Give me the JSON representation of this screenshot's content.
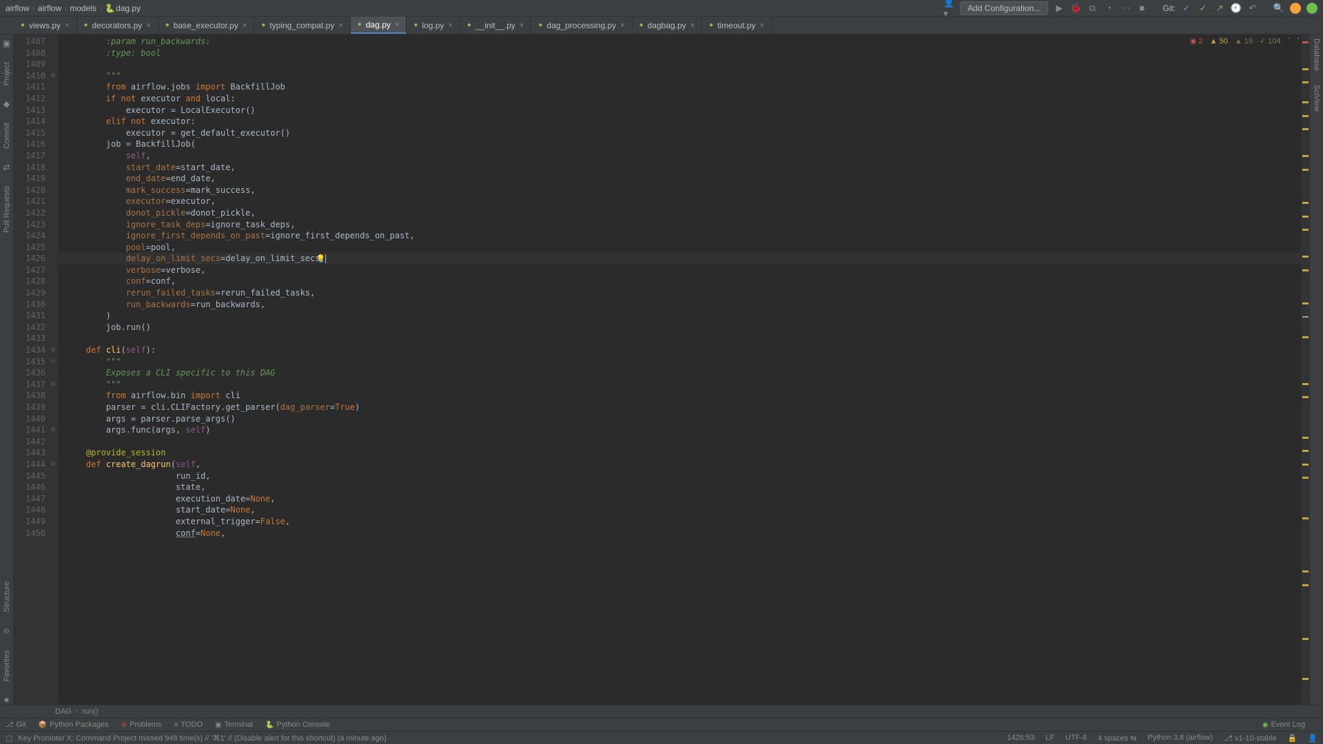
{
  "breadcrumb": [
    "airflow",
    "airflow",
    "models",
    "dag.py"
  ],
  "config_button": "Add Configuration...",
  "git_label": "Git:",
  "tabs": [
    {
      "label": "views.py",
      "active": false
    },
    {
      "label": "decorators.py",
      "active": false
    },
    {
      "label": "base_executor.py",
      "active": false
    },
    {
      "label": "typing_compat.py",
      "active": false
    },
    {
      "label": "dag.py",
      "active": true
    },
    {
      "label": "log.py",
      "active": false
    },
    {
      "label": "__init__.py",
      "active": false
    },
    {
      "label": "dag_processing.py",
      "active": false
    },
    {
      "label": "dagbag.py",
      "active": false
    },
    {
      "label": "timeout.py",
      "active": false
    }
  ],
  "left_tools": [
    "Project",
    "Commit",
    "Pull Requests",
    "Structure",
    "Favorites"
  ],
  "right_tools": [
    "Database",
    "SciView"
  ],
  "inspections": {
    "errors": "2",
    "warnings": "50",
    "weak": "19",
    "typos": "104"
  },
  "line_start": 1407,
  "line_end": 1450,
  "current_line": 1426,
  "bulb_line": 1426,
  "code_lines": [
    "        <span class='doc'>:param run_backwards:</span>",
    "        <span class='doc'>:type: bool</span>",
    "",
    "        <span class='doc'>\"\"\"</span>",
    "        <span class='kw'>from </span>airflow.jobs <span class='kw'>import </span>BackfillJob",
    "        <span class='kw'>if not </span>executor <span class='kw'>and </span>local:",
    "            executor = LocalExecutor()",
    "        <span class='kw'>elif not </span>executor:",
    "            executor = get_default_executor()",
    "        job = BackfillJob(",
    "            <span class='self'>self</span>,",
    "            <span class='param'>start_date</span>=start_date,",
    "            <span class='param'>end_date</span>=end_date,",
    "            <span class='param'>mark_success</span>=mark_success,",
    "            <span class='param'>executor</span>=executor,",
    "            <span class='param'>donot_pickle</span>=donot_pickle,",
    "            <span class='param'>ignore_task_deps</span>=ignore_task_deps,",
    "            <span class='param'>ignore_first_depends_on_past</span>=ignore_first_depends_on_past,",
    "            <span class='param'>pool</span>=pool,",
    "            <span class='param'>delay_on_limit_secs</span>=delay_on_limit_secs,<span class='caret'></span>",
    "            <span class='param'>verbose</span>=verbose,",
    "            <span class='param'>conf</span>=conf,",
    "            <span class='param'>rerun_failed_tasks</span>=rerun_failed_tasks,",
    "            <span class='param'>run_backwards</span>=run_backwards,",
    "        )",
    "        job.run()",
    "",
    "    <span class='kw'>def </span><span class='fn'>cli</span>(<span class='self'>self</span>):",
    "        <span class='doc'>\"\"\"</span>",
    "        <span class='doc'>Exposes a CLI specific to this DAG</span>",
    "        <span class='doc'>\"\"\"</span>",
    "        <span class='kw'>from </span>airflow.bin <span class='kw'>import </span>cli",
    "        parser = cli.CLIFactory.get_parser(<span class='param'>dag_parser</span>=<span class='kw'>True</span>)",
    "        args = parser.parse_args()",
    "        args.func(args, <span class='self'>self</span>)",
    "",
    "    <span class='deco'>@provide_session</span>",
    "    <span class='kw'>def </span><span class='fn'>create_dagrun</span>(<span class='self'>self</span>,",
    "                      run_id,",
    "                      state,",
    "                      execution_date=<span class='kw'>None</span>,",
    "                      start_date=<span class='kw'>None</span>,",
    "                      external_trigger=<span class='kw'>False</span>,",
    "                      <span class='under'>conf</span>=<span class='kw'>None</span>,"
  ],
  "fold_marks": {
    "1410": "⊟",
    "1434": "⊟",
    "1435": "⊟",
    "1437": "⊟",
    "1441": "⊟",
    "1444": "⊟"
  },
  "stripe_marks": [
    {
      "pct": 1,
      "cls": "m-e"
    },
    {
      "pct": 5,
      "cls": "m-w"
    },
    {
      "pct": 7,
      "cls": "m-w"
    },
    {
      "pct": 10,
      "cls": "m-w"
    },
    {
      "pct": 12,
      "cls": "m-w"
    },
    {
      "pct": 14,
      "cls": "m-w"
    },
    {
      "pct": 18,
      "cls": "m-w"
    },
    {
      "pct": 20,
      "cls": "m-w"
    },
    {
      "pct": 25,
      "cls": "m-w"
    },
    {
      "pct": 27,
      "cls": "m-w"
    },
    {
      "pct": 29,
      "cls": "m-w"
    },
    {
      "pct": 33,
      "cls": "m-w"
    },
    {
      "pct": 35,
      "cls": "m-w"
    },
    {
      "pct": 40,
      "cls": "m-w"
    },
    {
      "pct": 42,
      "cls": "m-cur"
    },
    {
      "pct": 45,
      "cls": "m-w"
    },
    {
      "pct": 52,
      "cls": "m-w"
    },
    {
      "pct": 54,
      "cls": "m-w"
    },
    {
      "pct": 60,
      "cls": "m-w"
    },
    {
      "pct": 62,
      "cls": "m-w"
    },
    {
      "pct": 64,
      "cls": "m-w"
    },
    {
      "pct": 66,
      "cls": "m-w"
    },
    {
      "pct": 72,
      "cls": "m-w"
    },
    {
      "pct": 80,
      "cls": "m-w"
    },
    {
      "pct": 82,
      "cls": "m-w"
    },
    {
      "pct": 90,
      "cls": "m-w"
    },
    {
      "pct": 96,
      "cls": "m-w"
    }
  ],
  "context": [
    "DAG",
    "run()"
  ],
  "bottom_tools": [
    {
      "icon": "⎇",
      "label": "Git"
    },
    {
      "icon": "📦",
      "label": "Python Packages"
    },
    {
      "icon": "⊘",
      "label": "Problems",
      "color": "#c75450"
    },
    {
      "icon": "≡",
      "label": "TODO"
    },
    {
      "icon": "▣",
      "label": "Terminal"
    },
    {
      "icon": "🐍",
      "label": "Python Console"
    }
  ],
  "event_log": "Event Log",
  "status_msg": "Key Promoter X: Command Project missed 948 time(s) // '⌘1' // (Disable alert for this shortcut) (a minute ago)",
  "status_right": {
    "pos": "1426:53",
    "le": "LF",
    "enc": "UTF-8",
    "indent": "4 spaces",
    "sdk": "Python 3.8 (airflow)",
    "branch": "v1-10-stable"
  }
}
